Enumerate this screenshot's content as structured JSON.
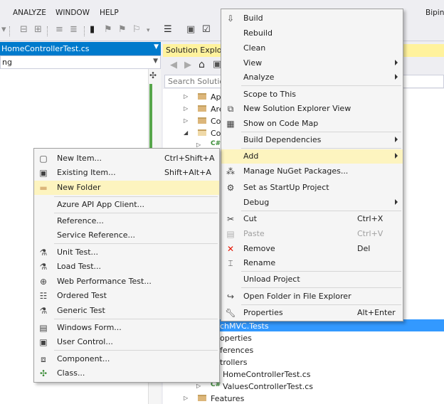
{
  "menubar": {
    "items": [
      "ANALYZE",
      "WINDOW",
      "HELP"
    ],
    "user": "Bipin"
  },
  "editor": {
    "tab_label": "HomeControllerTest.cs",
    "combo_value": "ng"
  },
  "solution_explorer": {
    "header": "Solution Explore",
    "search_placeholder": "Search Solution",
    "tree": [
      {
        "label": "Ap"
      },
      {
        "label": "Are"
      },
      {
        "label": "Co"
      },
      {
        "label": "Co"
      },
      {
        "label": "C#"
      },
      {
        "label": "chMVC.Tests"
      },
      {
        "label": "operties"
      },
      {
        "label": "ferences"
      },
      {
        "label": "trollers"
      },
      {
        "label": "HomeControllerTest.cs"
      },
      {
        "label": "ValuesControllerTest.cs"
      },
      {
        "label": "Features"
      }
    ]
  },
  "context_menu": {
    "items": [
      {
        "label": "Build",
        "icon": "build-icon"
      },
      {
        "label": "Rebuild"
      },
      {
        "label": "Clean"
      },
      {
        "label": "View",
        "submenu": true
      },
      {
        "label": "Analyze",
        "submenu": true
      },
      {
        "label": "Scope to This"
      },
      {
        "label": "New Solution Explorer View",
        "icon": "new-solution-explorer-view-icon"
      },
      {
        "label": "Show on Code Map",
        "icon": "code-map-icon"
      },
      {
        "label": "Build Dependencies",
        "submenu": true
      },
      {
        "label": "Add",
        "submenu": true,
        "highlighted": true
      },
      {
        "label": "Manage NuGet Packages...",
        "icon": "nuget-icon"
      },
      {
        "label": "Set as StartUp Project",
        "icon": "gear-icon"
      },
      {
        "label": "Debug",
        "submenu": true
      },
      {
        "label": "Cut",
        "shortcut": "Ctrl+X",
        "icon": "scissors-icon"
      },
      {
        "label": "Paste",
        "shortcut": "Ctrl+V",
        "disabled": true,
        "icon": "paste-icon"
      },
      {
        "label": "Remove",
        "shortcut": "Del",
        "icon": "remove-x-icon"
      },
      {
        "label": "Rename",
        "icon": "rename-icon"
      },
      {
        "label": "Unload Project"
      },
      {
        "label": "Open Folder in File Explorer",
        "icon": "open-folder-icon"
      },
      {
        "label": "Properties",
        "shortcut": "Alt+Enter",
        "icon": "wrench-icon"
      }
    ]
  },
  "add_submenu": {
    "items": [
      {
        "label": "New Item...",
        "shortcut": "Ctrl+Shift+A",
        "icon": "new-item-icon"
      },
      {
        "label": "Existing Item...",
        "shortcut": "Shift+Alt+A",
        "icon": "existing-item-icon"
      },
      {
        "label": "New Folder",
        "highlighted": true,
        "icon": "new-folder-icon"
      },
      {
        "label": "Azure API App Client..."
      },
      {
        "label": "Reference..."
      },
      {
        "label": "Service Reference..."
      },
      {
        "label": "Unit Test...",
        "icon": "flask-icon"
      },
      {
        "label": "Load Test...",
        "icon": "load-test-icon"
      },
      {
        "label": "Web Performance Test...",
        "icon": "web-test-icon"
      },
      {
        "label": "Ordered Test",
        "icon": "ordered-test-icon"
      },
      {
        "label": "Generic Test",
        "icon": "generic-test-icon"
      },
      {
        "label": "Windows Form...",
        "icon": "windows-form-icon"
      },
      {
        "label": "User Control...",
        "icon": "user-control-icon"
      },
      {
        "label": "Component...",
        "icon": "component-icon"
      },
      {
        "label": "Class...",
        "icon": "class-icon"
      }
    ]
  }
}
